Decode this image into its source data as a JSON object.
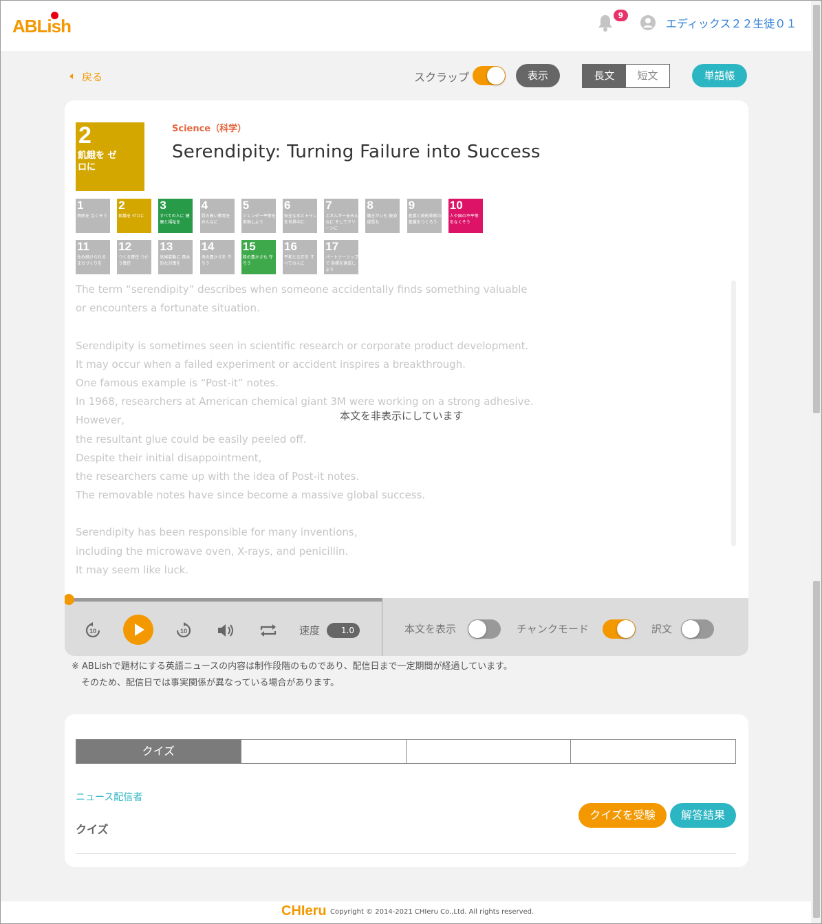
{
  "header": {
    "logo": "ABLish",
    "notification_count": "9",
    "user_name": "エディックス２２生徒０１"
  },
  "toolbar": {
    "back": "戻る",
    "scrap_label": "スクラップ",
    "show_button": "表示",
    "long_text": "長文",
    "short_text": "短文",
    "vocab_button": "単語帳"
  },
  "article": {
    "sdg_main": {
      "number": "2",
      "text": "飢餓を ゼロに"
    },
    "category": "Science（科学）",
    "title": "Serendipity: Turning Failure into Success",
    "sdg_tiles": [
      {
        "number": "1",
        "text": "貧困を なくそう"
      },
      {
        "number": "2",
        "text": "飢餓を ゼロに"
      },
      {
        "number": "3",
        "text": "すべての人に 健康と福祉を"
      },
      {
        "number": "4",
        "text": "質の高い教育を みんなに"
      },
      {
        "number": "5",
        "text": "ジェンダー平等を 実現しよう"
      },
      {
        "number": "6",
        "text": "安全な水とトイレ を世界中に"
      },
      {
        "number": "7",
        "text": "エネルギーをみんなに そしてクリーンに"
      },
      {
        "number": "8",
        "text": "働きがいも 経済成長も"
      },
      {
        "number": "9",
        "text": "産業と技術革新の 基盤をつくろう"
      },
      {
        "number": "10",
        "text": "人や国の不平等 をなくそう"
      },
      {
        "number": "11",
        "text": "住み続けられる まちづくりを"
      },
      {
        "number": "12",
        "text": "つくる責任 つかう責任"
      },
      {
        "number": "13",
        "text": "気候変動に 具体的な対策を"
      },
      {
        "number": "14",
        "text": "海の豊かさを 守ろう"
      },
      {
        "number": "15",
        "text": "陸の豊かさも 守ろう"
      },
      {
        "number": "16",
        "text": "平和と公正を すべての人に"
      },
      {
        "number": "17",
        "text": "パートナーシップで 目標を達成しよう"
      }
    ],
    "sdg_active_colors": {
      "2": "#d4a600",
      "3": "#279b48",
      "10": "#dd1367",
      "15": "#3ea94a"
    },
    "body_lines": [
      "The term “serendipity” describes when someone accidentally finds something valuable",
      "or encounters a fortunate situation.",
      "",
      "Serendipity is sometimes seen in scientific research or corporate product development.",
      "It may occur when a failed experiment or accident inspires a breakthrough.",
      "One famous example is “Post-it” notes.",
      "In 1968, researchers at American chemical giant 3M were working on a strong adhesive.",
      "However,",
      "the resultant glue could be easily peeled off.",
      "Despite their initial disappointment,",
      "the researchers came up with the idea of Post-it notes.",
      "The removable notes have since become a massive global success.",
      "",
      "Serendipity has been responsible for many inventions,",
      "including the microwave oven, X-rays, and penicillin.",
      "It may seem like luck."
    ],
    "hidden_message": "本文を非表示にしています"
  },
  "player": {
    "speed_label": "速度",
    "speed_value": "1.0",
    "show_text_label": "本文を表示",
    "chunk_mode_label": "チャンクモード",
    "translation_label": "訳文",
    "progress": 0
  },
  "notice": {
    "line1": "※ ABLishで題材にする英語ニュースの内容は制作段階のものであり、配信日まで一定期間が経過しています。",
    "line2": "そのため、配信日では事実関係が異なっている場合があります。"
  },
  "quiz": {
    "tabs": [
      "クイズ",
      "",
      "",
      ""
    ],
    "publisher": "ニュース配信者",
    "label": "クイズ",
    "take_button": "クイズを受験",
    "result_button": "解答結果"
  },
  "footer": {
    "logo": "CHIeru",
    "copyright": "Copyright © 2014-2021 CHIeru Co.,Ltd. All rights reserved."
  }
}
